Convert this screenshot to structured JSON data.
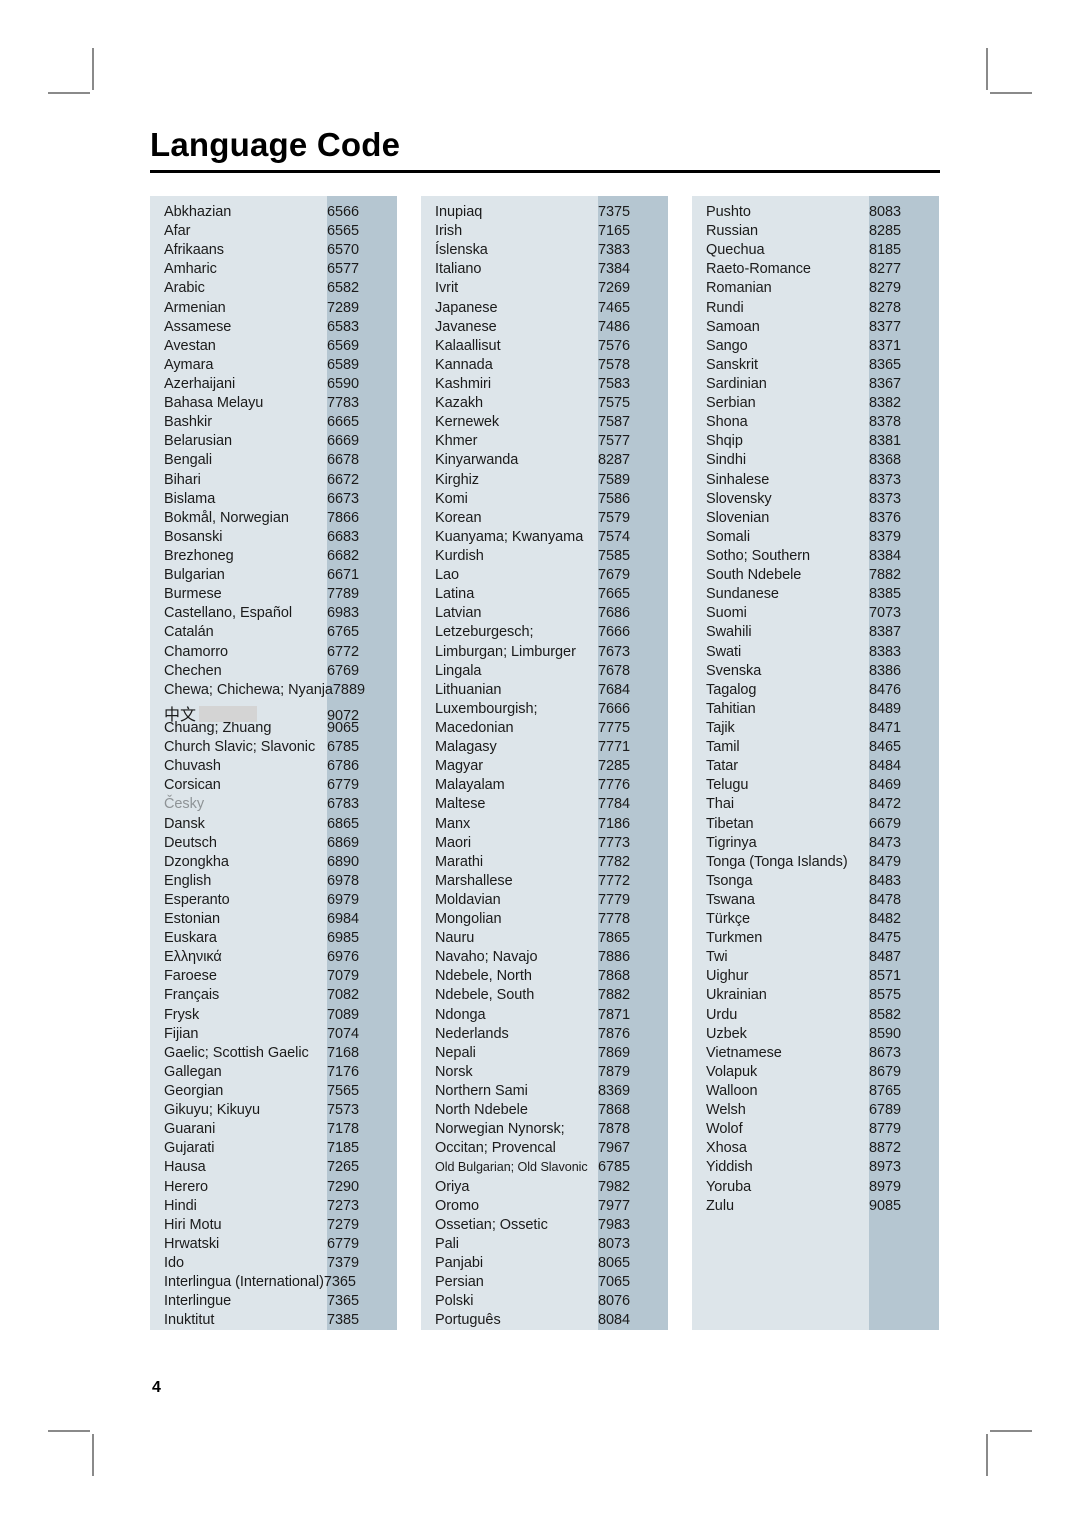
{
  "document": {
    "title": "Language Code",
    "page_number": "4"
  },
  "colors": {
    "name_cell_bg": "#dde5ea",
    "code_cell_bg": "#b5c6d1",
    "text": "#1b1b1b",
    "dim_text": "#8e9396",
    "redaction": "#d4d4d4",
    "rule": "#000000"
  },
  "columns": [
    {
      "id": "column-1",
      "rows": [
        {
          "name": "Abkhazian",
          "code": "6566"
        },
        {
          "name": "Afar",
          "code": "6565"
        },
        {
          "name": "Afrikaans",
          "code": "6570"
        },
        {
          "name": "Amharic",
          "code": "6577"
        },
        {
          "name": "Arabic",
          "code": "6582"
        },
        {
          "name": "Armenian",
          "code": "7289"
        },
        {
          "name": "Assamese",
          "code": "6583"
        },
        {
          "name": "Avestan",
          "code": "6569"
        },
        {
          "name": "Aymara",
          "code": "6589"
        },
        {
          "name": "Azerhaijani",
          "code": "6590"
        },
        {
          "name": "Bahasa Melayu",
          "code": "7783"
        },
        {
          "name": "Bashkir",
          "code": "6665"
        },
        {
          "name": "Belarusian",
          "code": "6669"
        },
        {
          "name": "Bengali",
          "code": "6678"
        },
        {
          "name": "Bihari",
          "code": "6672"
        },
        {
          "name": "Bislama",
          "code": "6673"
        },
        {
          "name": "Bokmål, Norwegian",
          "code": "7866"
        },
        {
          "name": "Bosanski",
          "code": "6683"
        },
        {
          "name": "Brezhoneg",
          "code": "6682"
        },
        {
          "name": "Bulgarian",
          "code": "6671"
        },
        {
          "name": "Burmese",
          "code": "7789"
        },
        {
          "name": "Castellano, Español",
          "code": "6983"
        },
        {
          "name": "Catalán",
          "code": "6765"
        },
        {
          "name": "Chamorro",
          "code": "6772"
        },
        {
          "name": "Chechen",
          "code": "6769"
        },
        {
          "name": "Chewa; Chichewa; Nyanja",
          "code": "7889",
          "wide": true
        },
        {
          "name": "中文",
          "code": "9072",
          "cjk": true,
          "redacted": true
        },
        {
          "name": "Chuang; Zhuang",
          "code": "9065"
        },
        {
          "name": "Church Slavic; Slavonic",
          "code": "6785"
        },
        {
          "name": "Chuvash",
          "code": "6786"
        },
        {
          "name": "Corsican",
          "code": "6779"
        },
        {
          "name": "Česky",
          "code": "6783",
          "dim": true
        },
        {
          "name": "Dansk",
          "code": "6865"
        },
        {
          "name": "Deutsch",
          "code": "6869"
        },
        {
          "name": "Dzongkha",
          "code": "6890"
        },
        {
          "name": "English",
          "code": "6978"
        },
        {
          "name": "Esperanto",
          "code": "6979"
        },
        {
          "name": "Estonian",
          "code": "6984"
        },
        {
          "name": "Euskara",
          "code": "6985"
        },
        {
          "name": "Ελληνικά",
          "code": "6976"
        },
        {
          "name": "Faroese",
          "code": "7079"
        },
        {
          "name": "Français",
          "code": "7082"
        },
        {
          "name": "Frysk",
          "code": "7089"
        },
        {
          "name": "Fijian",
          "code": "7074"
        },
        {
          "name": "Gaelic; Scottish Gaelic",
          "code": "7168"
        },
        {
          "name": "Gallegan",
          "code": "7176"
        },
        {
          "name": "Georgian",
          "code": "7565"
        },
        {
          "name": "Gikuyu; Kikuyu",
          "code": "7573"
        },
        {
          "name": "Guarani",
          "code": "7178"
        },
        {
          "name": "Gujarati",
          "code": "7185"
        },
        {
          "name": "Hausa",
          "code": "7265"
        },
        {
          "name": "Herero",
          "code": "7290"
        },
        {
          "name": "Hindi",
          "code": "7273"
        },
        {
          "name": "Hiri Motu",
          "code": "7279"
        },
        {
          "name": "Hrwatski",
          "code": "6779"
        },
        {
          "name": "Ido",
          "code": "7379"
        },
        {
          "name": "Interlingua (International)",
          "code": "7365",
          "wide": true
        },
        {
          "name": "Interlingue",
          "code": "7365"
        },
        {
          "name": "Inuktitut",
          "code": "7385"
        }
      ]
    },
    {
      "id": "column-2",
      "rows": [
        {
          "name": "Inupiaq",
          "code": "7375"
        },
        {
          "name": "Irish",
          "code": "7165"
        },
        {
          "name": "Íslenska",
          "code": "7383"
        },
        {
          "name": "Italiano",
          "code": "7384"
        },
        {
          "name": "Ivrit",
          "code": "7269"
        },
        {
          "name": "Japanese",
          "code": "7465"
        },
        {
          "name": "Javanese",
          "code": "7486"
        },
        {
          "name": "Kalaallisut",
          "code": "7576"
        },
        {
          "name": "Kannada",
          "code": "7578"
        },
        {
          "name": "Kashmiri",
          "code": "7583"
        },
        {
          "name": "Kazakh",
          "code": "7575"
        },
        {
          "name": "Kernewek",
          "code": "7587"
        },
        {
          "name": "Khmer",
          "code": "7577"
        },
        {
          "name": "Kinyarwanda",
          "code": "8287"
        },
        {
          "name": "Kirghiz",
          "code": "7589"
        },
        {
          "name": "Komi",
          "code": "7586"
        },
        {
          "name": "Korean",
          "code": "7579"
        },
        {
          "name": "Kuanyama; Kwanyama",
          "code": "7574"
        },
        {
          "name": "Kurdish",
          "code": "7585"
        },
        {
          "name": "Lao",
          "code": "7679"
        },
        {
          "name": "Latina",
          "code": "7665"
        },
        {
          "name": "Latvian",
          "code": "7686"
        },
        {
          "name": "Letzeburgesch;",
          "code": "7666"
        },
        {
          "name": "Limburgan; Limburger",
          "code": "7673"
        },
        {
          "name": "Lingala",
          "code": "7678"
        },
        {
          "name": "Lithuanian",
          "code": "7684"
        },
        {
          "name": "Luxembourgish;",
          "code": "7666"
        },
        {
          "name": "Macedonian",
          "code": "7775"
        },
        {
          "name": "Malagasy",
          "code": "7771"
        },
        {
          "name": "Magyar",
          "code": "7285"
        },
        {
          "name": "Malayalam",
          "code": "7776"
        },
        {
          "name": "Maltese",
          "code": "7784"
        },
        {
          "name": "Manx",
          "code": "7186"
        },
        {
          "name": "Maori",
          "code": "7773"
        },
        {
          "name": "Marathi",
          "code": "7782"
        },
        {
          "name": "Marshallese",
          "code": "7772"
        },
        {
          "name": "Moldavian",
          "code": "7779"
        },
        {
          "name": "Mongolian",
          "code": "7778"
        },
        {
          "name": "Nauru",
          "code": "7865"
        },
        {
          "name": "Navaho; Navajo",
          "code": "7886"
        },
        {
          "name": "Ndebele, North",
          "code": "7868"
        },
        {
          "name": "Ndebele, South",
          "code": "7882"
        },
        {
          "name": "Ndonga",
          "code": "7871"
        },
        {
          "name": "Nederlands",
          "code": "7876"
        },
        {
          "name": "Nepali",
          "code": "7869"
        },
        {
          "name": "Norsk",
          "code": "7879"
        },
        {
          "name": "Northern Sami",
          "code": "8369"
        },
        {
          "name": "North Ndebele",
          "code": "7868"
        },
        {
          "name": "Norwegian Nynorsk;",
          "code": "7878"
        },
        {
          "name": "Occitan; Provencal",
          "code": "7967"
        },
        {
          "name": "Old Bulgarian; Old Slavonic",
          "code": "6785",
          "small": true
        },
        {
          "name": "Oriya",
          "code": "7982"
        },
        {
          "name": "Oromo",
          "code": "7977"
        },
        {
          "name": "Ossetian; Ossetic",
          "code": "7983"
        },
        {
          "name": "Pali",
          "code": "8073"
        },
        {
          "name": "Panjabi",
          "code": "8065"
        },
        {
          "name": "Persian",
          "code": "7065"
        },
        {
          "name": "Polski",
          "code": "8076"
        },
        {
          "name": "Português",
          "code": "8084"
        }
      ]
    },
    {
      "id": "column-3",
      "rows": [
        {
          "name": "Pushto",
          "code": "8083"
        },
        {
          "name": "Russian",
          "code": "8285"
        },
        {
          "name": "Quechua",
          "code": "8185"
        },
        {
          "name": "Raeto-Romance",
          "code": "8277"
        },
        {
          "name": "Romanian",
          "code": "8279"
        },
        {
          "name": "Rundi",
          "code": "8278"
        },
        {
          "name": "Samoan",
          "code": "8377"
        },
        {
          "name": "Sango",
          "code": "8371"
        },
        {
          "name": "Sanskrit",
          "code": "8365"
        },
        {
          "name": "Sardinian",
          "code": "8367"
        },
        {
          "name": "Serbian",
          "code": "8382"
        },
        {
          "name": "Shona",
          "code": "8378"
        },
        {
          "name": "Shqip",
          "code": "8381"
        },
        {
          "name": "Sindhi",
          "code": "8368"
        },
        {
          "name": "Sinhalese",
          "code": "8373"
        },
        {
          "name": "Slovensky",
          "code": "8373"
        },
        {
          "name": "Slovenian",
          "code": "8376"
        },
        {
          "name": "Somali",
          "code": "8379"
        },
        {
          "name": "Sotho; Southern",
          "code": "8384"
        },
        {
          "name": "South Ndebele",
          "code": "7882"
        },
        {
          "name": "Sundanese",
          "code": "8385"
        },
        {
          "name": "Suomi",
          "code": "7073"
        },
        {
          "name": "Swahili",
          "code": "8387"
        },
        {
          "name": "Swati",
          "code": "8383"
        },
        {
          "name": "Svenska",
          "code": "8386"
        },
        {
          "name": "Tagalog",
          "code": "8476"
        },
        {
          "name": "Tahitian",
          "code": "8489"
        },
        {
          "name": "Tajik",
          "code": "8471"
        },
        {
          "name": "Tamil",
          "code": "8465"
        },
        {
          "name": "Tatar",
          "code": "8484"
        },
        {
          "name": "Telugu",
          "code": "8469"
        },
        {
          "name": "Thai",
          "code": "8472"
        },
        {
          "name": "Tibetan",
          "code": "6679"
        },
        {
          "name": "Tigrinya",
          "code": "8473"
        },
        {
          "name": "Tonga (Tonga Islands)",
          "code": "8479"
        },
        {
          "name": "Tsonga",
          "code": "8483"
        },
        {
          "name": "Tswana",
          "code": "8478"
        },
        {
          "name": "Türkçe",
          "code": "8482"
        },
        {
          "name": "Turkmen",
          "code": "8475"
        },
        {
          "name": "Twi",
          "code": "8487"
        },
        {
          "name": "Uighur",
          "code": "8571"
        },
        {
          "name": "Ukrainian",
          "code": "8575"
        },
        {
          "name": "Urdu",
          "code": "8582"
        },
        {
          "name": "Uzbek",
          "code": "8590"
        },
        {
          "name": "Vietnamese",
          "code": "8673"
        },
        {
          "name": "Volapuk",
          "code": "8679"
        },
        {
          "name": "Walloon",
          "code": "8765"
        },
        {
          "name": "Welsh",
          "code": "6789"
        },
        {
          "name": "Wolof",
          "code": "8779"
        },
        {
          "name": "Xhosa",
          "code": "8872"
        },
        {
          "name": "Yiddish",
          "code": "8973"
        },
        {
          "name": "Yoruba",
          "code": "8979"
        },
        {
          "name": "Zulu",
          "code": "9085"
        }
      ]
    }
  ]
}
